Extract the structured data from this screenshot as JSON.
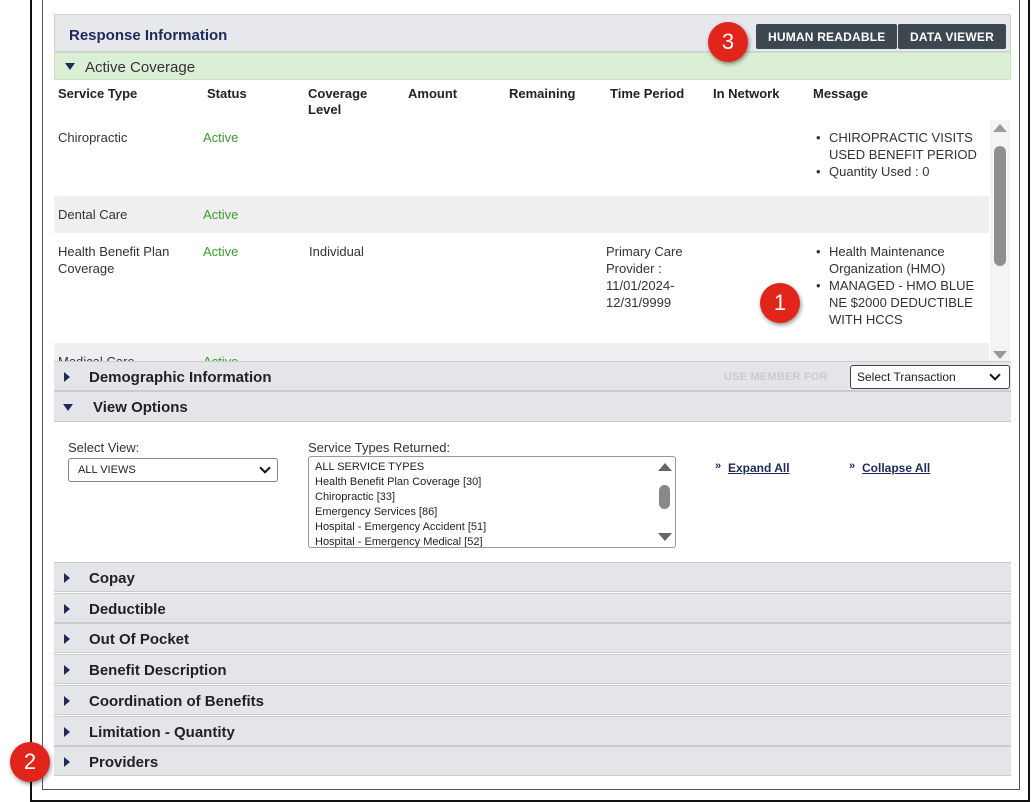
{
  "response": {
    "title": "Response Information",
    "human_readable_label": "HUMAN READABLE",
    "data_viewer_label": "DATA VIEWER"
  },
  "active_coverage": {
    "label": "Active Coverage",
    "columns": [
      "Service Type",
      "Status",
      "Coverage Level",
      "Amount",
      "Remaining",
      "Time Period",
      "In Network",
      "Message"
    ],
    "rows": [
      {
        "service_type": "Chiropractic",
        "status": "Active",
        "coverage_level": "",
        "time_period": "",
        "messages": [
          "CHIROPRACTIC VISITS USED BENEFIT PERIOD",
          "Quantity Used : 0"
        ]
      },
      {
        "service_type": "Dental Care",
        "status": "Active",
        "coverage_level": "",
        "time_period": "",
        "messages": []
      },
      {
        "service_type": "Health Benefit Plan Coverage",
        "status": "Active",
        "coverage_level": "Individual",
        "time_period": "Primary Care Provider : 11/01/2024-12/31/9999",
        "messages": [
          "Health Maintenance Organization (HMO)",
          "MANAGED - HMO BLUE NE $2000 DEDUCTIBLE WITH HCCS"
        ]
      },
      {
        "service_type": "Medical Care",
        "status": "Active",
        "coverage_level": "",
        "time_period": "",
        "messages": []
      }
    ]
  },
  "demographic": {
    "title": "Demographic Information",
    "use_member_for": "USE MEMBER FOR",
    "select_transaction": "Select Transaction"
  },
  "view_options": {
    "title": "View Options",
    "select_view_label": "Select View:",
    "select_view_value": "ALL VIEWS",
    "service_types_label": "Service Types Returned:",
    "service_types": [
      "ALL SERVICE TYPES",
      "Health Benefit Plan Coverage [30]",
      "Chiropractic [33]",
      "Emergency Services [86]",
      "Hospital - Emergency Accident [51]",
      "Hospital - Emergency Medical [52]"
    ],
    "expand_all": "Expand All",
    "collapse_all": "Collapse All",
    "expand_icon": "double-chevron-down-icon",
    "collapse_icon": "double-chevron-right-icon"
  },
  "sections": [
    "Copay",
    "Deductible",
    "Out Of Pocket",
    "Benefit Description",
    "Coordination of Benefits",
    "Limitation - Quantity",
    "Providers"
  ],
  "callouts": [
    "1",
    "2",
    "3"
  ],
  "colors": {
    "header_navy": "#1f2a5a",
    "active_green": "#3a9d2b",
    "coverage_bar": "#dcefd6",
    "button_dark": "#3c4750",
    "callout_red": "#e1251b"
  }
}
